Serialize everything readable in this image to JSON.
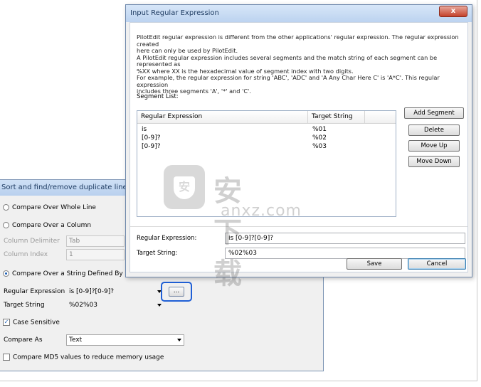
{
  "background_dialog": {
    "title": "Sort and find/remove duplicate lines",
    "options": {
      "whole_line": "Compare Over Whole Line",
      "column": "Compare Over a Column",
      "column_delimiter_label": "Column Delimiter",
      "column_delimiter_value": "Tab",
      "column_index_label": "Column Index",
      "column_index_value": "1",
      "string_defined": "Compare Over a String Defined By Regula",
      "regex_label": "Regular Expression",
      "regex_value": "is [0-9]?[0-9]?",
      "ellipsis_button": "...",
      "target_label": "Target String",
      "target_value": "%02%03",
      "case_sensitive": "Case Sensitive",
      "compare_as_label": "Compare As",
      "compare_as_value": "Text",
      "md5": "Compare MD5 values to reduce memory usage"
    }
  },
  "dialog": {
    "title": "Input Regular Expression",
    "close_label": "x",
    "description": [
      "PilotEdit regular expression is different from the other applications' regular expression. The regular expression created",
      "here can only be used by PilotEdit.",
      "A PilotEdit regular expression includes several segments and the match string of each segment can be represented as",
      "%XX where XX is the hexadecimal value of segment index with two digits.",
      "For example, the regular expression for string 'ABC', 'ADC' and 'A Any Char Here C' is 'A*C'. This regular expression",
      "includes three segments 'A', '*' and 'C'."
    ],
    "segment_list_label": "Segment List:",
    "columns": [
      "Regular Expression",
      "Target String"
    ],
    "rows": [
      {
        "regex": "is",
        "target": "%01"
      },
      {
        "regex": "[0-9]?",
        "target": "%02"
      },
      {
        "regex": "[0-9]?",
        "target": "%03"
      }
    ],
    "buttons": {
      "add_segment": "Add Segment",
      "delete": "Delete",
      "move_up": "Move Up",
      "move_down": "Move Down",
      "save": "Save",
      "cancel": "Cancel"
    },
    "regex_field_label": "Regular Expression:",
    "regex_field_value": "is [0-9]?[0-9]?",
    "target_field_label": "Target String:",
    "target_field_value": "%02%03"
  },
  "watermark": {
    "chinese": "安下载",
    "domain": "anxz.com"
  }
}
